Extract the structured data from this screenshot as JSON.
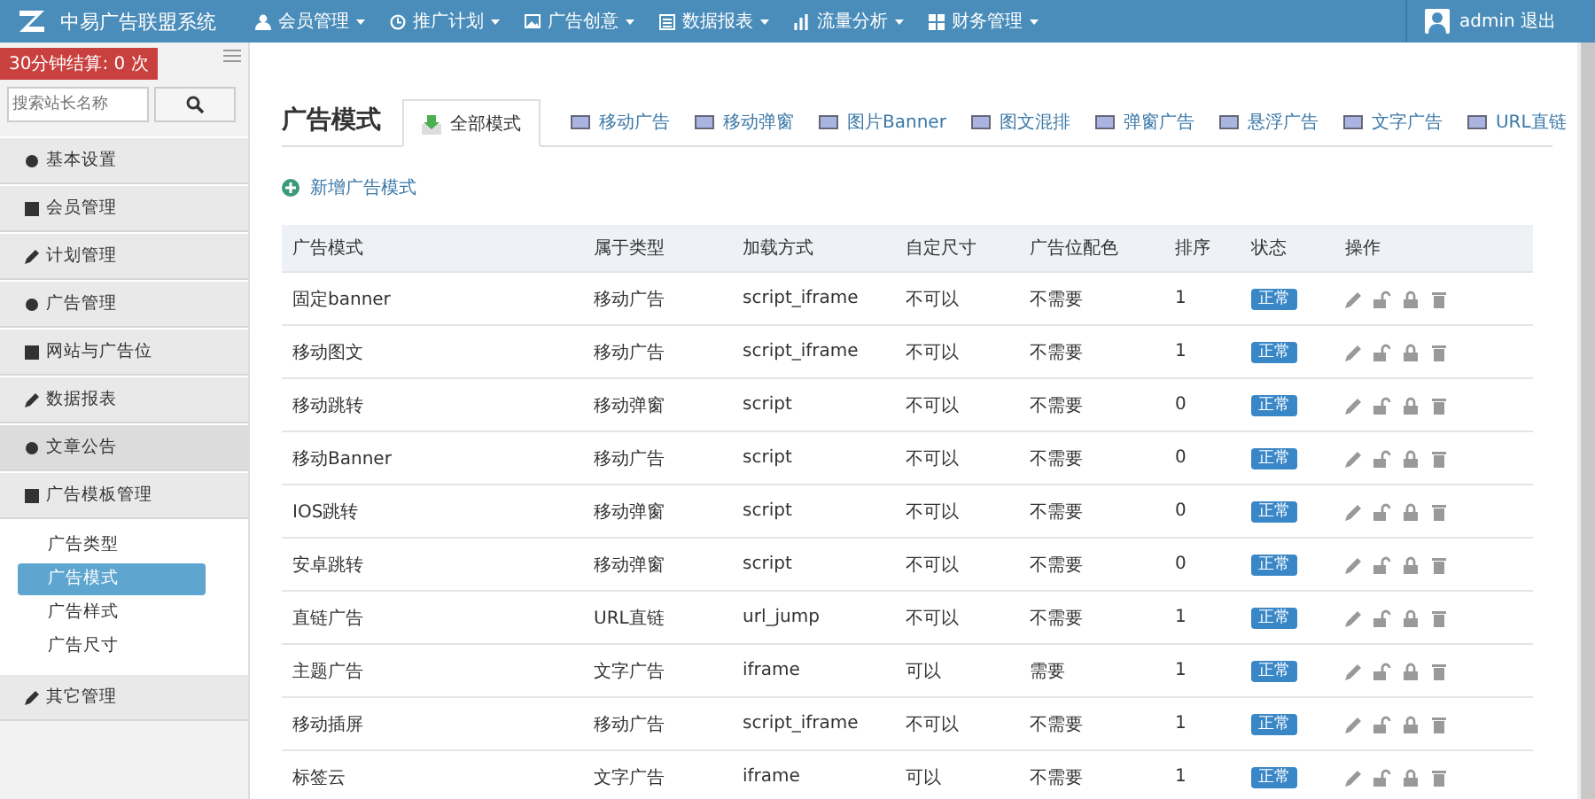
{
  "app": {
    "title": "中易广告联盟系统"
  },
  "nav": [
    {
      "label": "会员管理"
    },
    {
      "label": "推广计划"
    },
    {
      "label": "广告创意"
    },
    {
      "label": "数据报表"
    },
    {
      "label": "流量分析"
    },
    {
      "label": "财务管理"
    }
  ],
  "user": {
    "name": "admin",
    "logout": "退出"
  },
  "sidebar": {
    "settle_badge": "30分钟结算: 0 次",
    "search": {
      "placeholder": "搜索站长名称"
    },
    "items": [
      {
        "label": "基本设置",
        "selected": false
      },
      {
        "label": "会员管理",
        "selected": false
      },
      {
        "label": "计划管理",
        "selected": false
      },
      {
        "label": "广告管理",
        "selected": false
      },
      {
        "label": "网站与广告位",
        "selected": false
      },
      {
        "label": "数据报表",
        "selected": false
      },
      {
        "label": "文章公告",
        "selected": true
      },
      {
        "label": "广告模板管理",
        "selected": false,
        "expanded": true,
        "children": [
          {
            "label": "广告类型",
            "selected": false
          },
          {
            "label": "广告模式",
            "selected": true
          },
          {
            "label": "广告样式",
            "selected": false
          },
          {
            "label": "广告尺寸",
            "selected": false
          }
        ]
      },
      {
        "label": "其它管理",
        "selected": false
      }
    ]
  },
  "page": {
    "title": "广告模式",
    "tabs": [
      {
        "label": "全部模式",
        "selected": true
      },
      {
        "label": "移动广告",
        "selected": false
      },
      {
        "label": "移动弹窗",
        "selected": false
      },
      {
        "label": "图片Banner",
        "selected": false
      },
      {
        "label": "图文混排",
        "selected": false
      },
      {
        "label": "弹窗广告",
        "selected": false
      },
      {
        "label": "悬浮广告",
        "selected": false
      },
      {
        "label": "文字广告",
        "selected": false
      },
      {
        "label": "URL直链",
        "selected": false
      }
    ],
    "add_link": "新增广告模式",
    "table": {
      "columns": [
        "广告模式",
        "属于类型",
        "加载方式",
        "自定尺寸",
        "广告位配色",
        "排序",
        "状态",
        "操作"
      ],
      "rows": [
        {
          "name": "固定banner",
          "type": "移动广告",
          "load": "script_iframe",
          "custom_size": "不可以",
          "color_match": "不需要",
          "order": "1",
          "status": "正常"
        },
        {
          "name": "移动图文",
          "type": "移动广告",
          "load": "script_iframe",
          "custom_size": "不可以",
          "color_match": "不需要",
          "order": "1",
          "status": "正常"
        },
        {
          "name": "移动跳转",
          "type": "移动弹窗",
          "load": "script",
          "custom_size": "不可以",
          "color_match": "不需要",
          "order": "0",
          "status": "正常"
        },
        {
          "name": "移动Banner",
          "type": "移动广告",
          "load": "script",
          "custom_size": "不可以",
          "color_match": "不需要",
          "order": "0",
          "status": "正常"
        },
        {
          "name": "IOS跳转",
          "type": "移动弹窗",
          "load": "script",
          "custom_size": "不可以",
          "color_match": "不需要",
          "order": "0",
          "status": "正常"
        },
        {
          "name": "安卓跳转",
          "type": "移动弹窗",
          "load": "script",
          "custom_size": "不可以",
          "color_match": "不需要",
          "order": "0",
          "status": "正常"
        },
        {
          "name": "直链广告",
          "type": "URL直链",
          "load": "url_jump",
          "custom_size": "不可以",
          "color_match": "不需要",
          "order": "1",
          "status": "正常"
        },
        {
          "name": "主题广告",
          "type": "文字广告",
          "load": "iframe",
          "custom_size": "可以",
          "color_match": "需要",
          "order": "1",
          "status": "正常"
        },
        {
          "name": "移动插屏",
          "type": "移动广告",
          "load": "script_iframe",
          "custom_size": "不可以",
          "color_match": "不需要",
          "order": "1",
          "status": "正常"
        },
        {
          "name": "标签云",
          "type": "文字广告",
          "load": "iframe",
          "custom_size": "可以",
          "color_match": "不需要",
          "order": "1",
          "status": "正常"
        }
      ]
    }
  }
}
